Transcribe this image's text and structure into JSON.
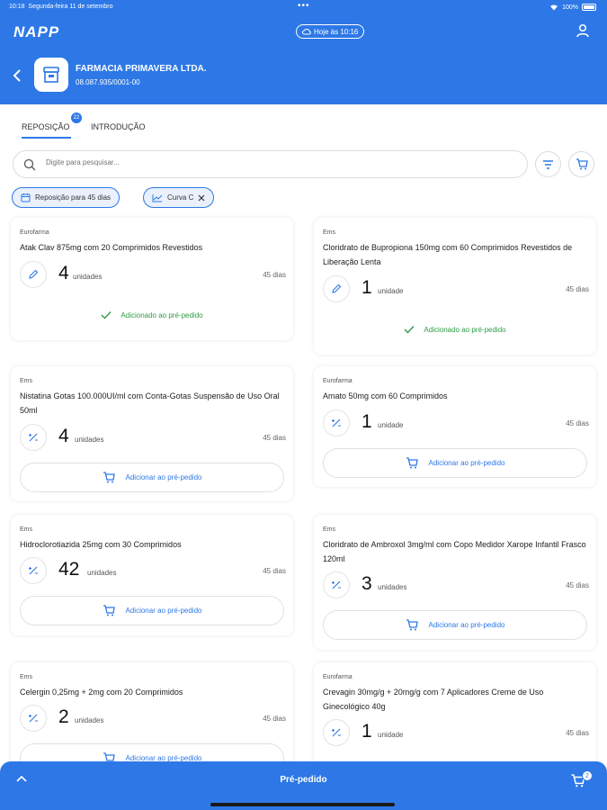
{
  "status_bar": {
    "time": "10:18",
    "date": "Segunda-feira 11 de setembro",
    "dots": "•••",
    "battery": "100%"
  },
  "header": {
    "logo": "NAPP",
    "sync_label": "Hoje às 10:16",
    "store_name": "FARMACIA PRIMAVERA LTDA.",
    "store_cnpj": "08.087.935/0001-00"
  },
  "tabs": [
    {
      "label": "REPOSIÇÃO",
      "badge": "22",
      "active": true
    },
    {
      "label": "INTRODUÇÃO",
      "active": false
    }
  ],
  "search": {
    "placeholder": "Digite para pesquisar..."
  },
  "filters": [
    {
      "label": "Reposição para 45 dias"
    },
    {
      "label": "Curva C"
    }
  ],
  "labels": {
    "add_to_preorder": "Adicionar ao pré-pedido",
    "added_to_preorder": "Adicionado ao pré-pedido"
  },
  "products": [
    {
      "brand": "Eurofarma",
      "name": "Atak Clav 875mg com 20 Comprimidos Revestidos",
      "qty": "4",
      "unit": "unidades",
      "days": "45 dias",
      "added": true
    },
    {
      "brand": "Ems",
      "name": "Cloridrato de Bupropiona 150mg com 60 Comprimidos Revestidos de Liberação Lenta",
      "qty": "1",
      "unit": "unidade",
      "days": "45 dias",
      "added": true
    },
    {
      "brand": "Ems",
      "name": "Nistatina Gotas 100.000UI/ml com Conta-Gotas Suspensão de Uso Oral 50ml",
      "qty": "4",
      "unit": "unidades",
      "days": "45 dias",
      "added": false
    },
    {
      "brand": "Eurofarma",
      "name": "Amato 50mg com 60 Comprimidos",
      "qty": "1",
      "unit": "unidade",
      "days": "45 dias",
      "added": false
    },
    {
      "brand": "Ems",
      "name": "Hidroclorotiazida 25mg com 30 Comprimidos",
      "qty": "42",
      "unit": "unidades",
      "days": "45 dias",
      "added": false
    },
    {
      "brand": "Ems",
      "name": "Cloridrato de Ambroxol 3mg/ml com Copo Medidor Xarope Infantil Frasco 120ml",
      "qty": "3",
      "unit": "unidades",
      "days": "45 dias",
      "added": false
    },
    {
      "brand": "Ems",
      "name": "Celergin 0,25mg + 2mg com 20 Comprimidos",
      "qty": "2",
      "unit": "unidades",
      "days": "45 dias",
      "added": false
    },
    {
      "brand": "Eurofarma",
      "name": "Crevagin 30mg/g + 20mg/g com 7 Aplicadores Creme de Uso Ginecológico 40g",
      "qty": "1",
      "unit": "unidade",
      "days": "45 dias",
      "added": false
    }
  ],
  "bottom_bar": {
    "title": "Pré-pedido",
    "cart_count": "2"
  },
  "colors": {
    "primary": "#2d78e6",
    "success": "#2e9b45"
  }
}
